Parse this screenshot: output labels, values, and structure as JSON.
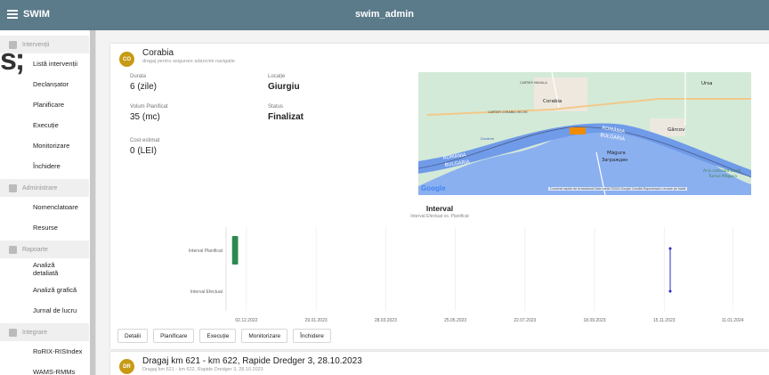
{
  "header": {
    "app_name": "SWIM",
    "user": "swim_admin"
  },
  "sidebar": {
    "sections": [
      {
        "label": "Intervenții",
        "icon": "clipboard-icon",
        "items": [
          "Listă intervenții",
          "Declanșator",
          "Planificare",
          "Execuție",
          "Monitorizare",
          "Închidere"
        ]
      },
      {
        "label": "Administrare",
        "icon": "gears-icon",
        "items": [
          "Nomenclatoare",
          "Resurse"
        ]
      },
      {
        "label": "Rapoarte",
        "icon": "report-icon",
        "items": [
          "Analiză detaliată",
          "Analiză grafică",
          "Jurnal de lucru"
        ]
      },
      {
        "label": "Integrare",
        "icon": "integration-icon",
        "items": [
          "RoRIX-RISIndex",
          "WAMS-RMMs"
        ]
      }
    ]
  },
  "artifact": "s;",
  "card": {
    "avatar": "CO",
    "title": "Corabia",
    "subtitle": "dragaj pentru asigurare adancimi navigatie",
    "durata_label": "Durata",
    "durata_value": "6 (zile)",
    "locatie_label": "Locație",
    "locatie_value": "Giurgiu",
    "volum_label": "Volum Planificat",
    "volum_value": "35 (mc)",
    "status_label": "Status",
    "status_value": "Finalizat",
    "cost_label": "Cost estimat",
    "cost_value": "0 (LEI)",
    "actions": [
      "Detalii",
      "Planificare",
      "Execuție",
      "Monitorizare",
      "Închidere"
    ]
  },
  "map": {
    "labels": {
      "cartier_mahala": "CARTIER MAHALA",
      "cartier_corabia_veche": "CARTIER CORABIA VECHE",
      "corabia": "Corabia",
      "ursa": "Ursa",
      "garcov": "Gârcov",
      "romania_bulgaria_1": "ROMÂNIA",
      "romania_bulgaria_2": "BULGARIA",
      "romania_bulgaria_3": "ROMÂNIA",
      "romania_bulgaria_4": "BULGARIA",
      "magura": "Măgura",
      "zagrazhden": "Загражден",
      "aria_naturala": "Aria naturală Coral",
      "turnul_magura": "Turnul Măgura",
      "river_dunarea": "Dunărea"
    },
    "google": "Google",
    "attribution": "Comenzi rapide de la tastatură  Date hartă ©2023 Google  Condiții  Raportează o eroare pe hartă"
  },
  "chart": {
    "title": "Interval",
    "subtitle": "Interval Efectuat vs. Planificat"
  },
  "chart_data": {
    "type": "bar",
    "categories": [
      "Interval Planificat",
      "Interval Efectuat"
    ],
    "x_ticks": [
      "02.12.2022",
      "29.01.2023",
      "28.03.2023",
      "25.05.2023",
      "22.07.2023",
      "18.09.2023",
      "15.11.2023",
      "11.01.2024"
    ],
    "series": [
      {
        "name": "Interval Planificat",
        "color": "#2d8a4e",
        "start": "2022-11-20",
        "end": "2022-11-25"
      },
      {
        "name": "Interval Efectuat",
        "color": "#2b2bc7",
        "start": "2023-11-20",
        "end": "2023-11-20"
      }
    ],
    "xlim": [
      "2022-11-15",
      "2024-01-25"
    ],
    "grid": true
  },
  "card2": {
    "avatar": "DR",
    "title": "Dragaj km 621 - km 622, Rapide Dredger 3, 28.10.2023",
    "subtitle": "Dragaj km 621 - km 622, Rapide Dredger 3, 28.10.2023"
  },
  "colors": {
    "topbar": "#5b7a8a",
    "avatar": "#c79a13",
    "river": "#6f9be8",
    "marker": "#f08c00"
  }
}
